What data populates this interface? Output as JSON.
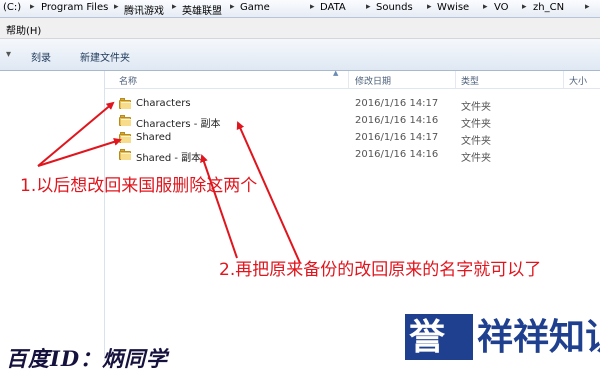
{
  "address_bar": {
    "segments": [
      "(C:)",
      "Program Files",
      "腾讯游戏",
      "英雄联盟",
      "Game",
      "DATA",
      "Sounds",
      "Wwise",
      "VO",
      "zh_CN"
    ],
    "separator": "▸"
  },
  "menubar": {
    "help": "帮助(H)"
  },
  "toolbar": {
    "burn": "刻录",
    "new_folder": "新建文件夹"
  },
  "columns": {
    "name": "名称",
    "date": "修改日期",
    "type": "类型",
    "size": "大小"
  },
  "files": [
    {
      "name": "Characters",
      "date": "2016/1/16 14:17",
      "type": "文件夹"
    },
    {
      "name": "Characters - 副本",
      "date": "2016/1/16 14:16",
      "type": "文件夹"
    },
    {
      "name": "Shared",
      "date": "2016/1/16 14:17",
      "type": "文件夹"
    },
    {
      "name": "Shared - 副本",
      "date": "2016/1/16 14:16",
      "type": "文件夹"
    }
  ],
  "annotations": {
    "note1": "1.以后想改回来国服删除这两个",
    "note2": "2.再把原来备份的改回原来的名字就可以了"
  },
  "watermark": {
    "baidu_id": "百度ID：炳同学",
    "logo_left": "誉",
    "logo_right": "祥祥知识"
  },
  "colors": {
    "annotation": "#e0151d",
    "logo": "#1f3f8f",
    "folder": "#e7bf58"
  },
  "icons": {
    "folder": "folder-icon",
    "sort": "sort-up-icon"
  }
}
